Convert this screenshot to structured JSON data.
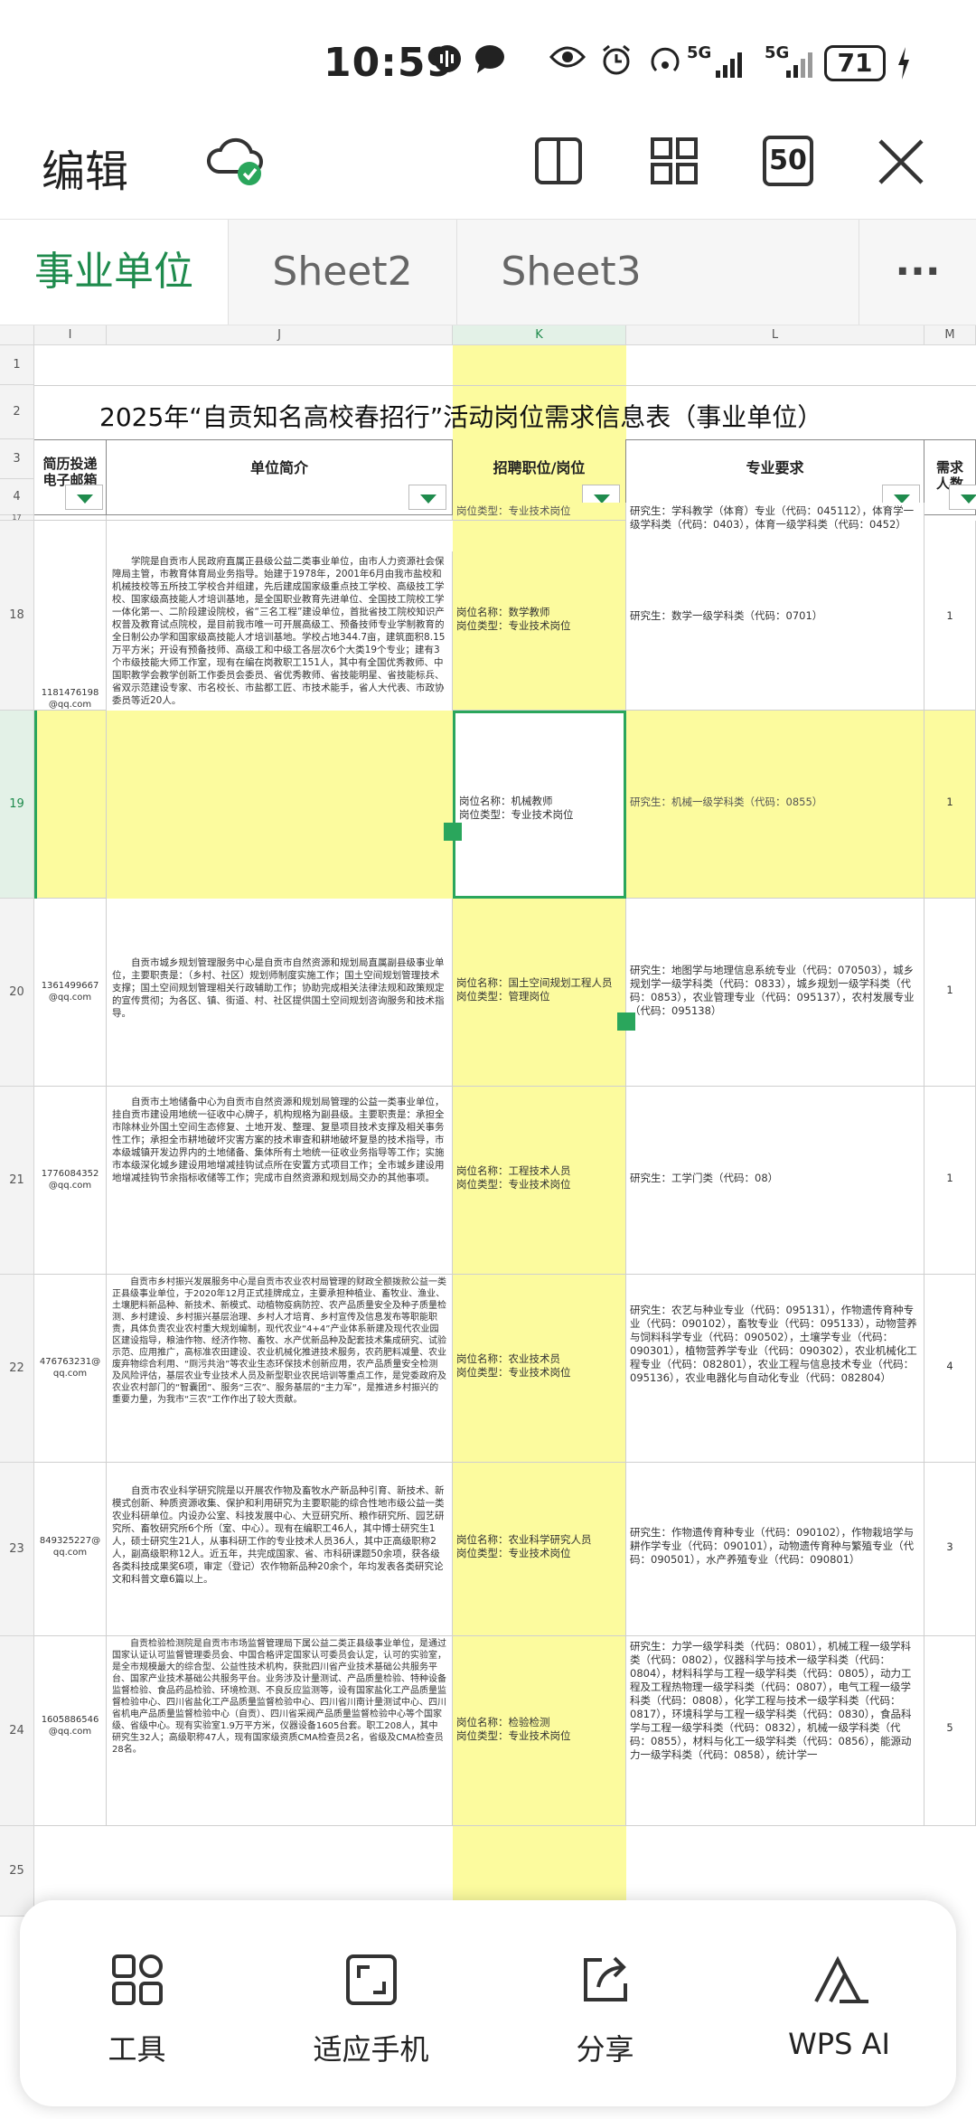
{
  "status_bar": {
    "time": "10:59",
    "signal1": "5G",
    "signal2": "5G",
    "battery": "71"
  },
  "toolbar": {
    "edit_label": "编辑",
    "zoom_value": "50"
  },
  "tabs": [
    {
      "label": "事业单位"
    },
    {
      "label": "Sheet2"
    },
    {
      "label": "Sheet3"
    }
  ],
  "more_label": "···",
  "columns": [
    "I",
    "J",
    "K",
    "L",
    "M"
  ],
  "rows": [
    "1",
    "2",
    "3",
    "4",
    "17",
    "18",
    "19",
    "20",
    "21",
    "22",
    "23",
    "24",
    "25"
  ],
  "sheet_title": "2025年“自贡知名高校春招行”活动岗位需求信息表（事业单位）",
  "headers": {
    "email": "简历投递\n电子邮箱",
    "intro": "单位简介",
    "post": "招聘职位/岗位",
    "major": "专业要求",
    "count": "需求\n人数"
  },
  "data_rows": [
    {
      "row": "17",
      "email": "",
      "intro": "",
      "post": "岗位类型：专业技术岗位",
      "major": "研究生：学科教学（体育）专业（代码：045112），体育学一级学科类（代码：0403），体育一级学科类（代码：0452）",
      "count": ""
    },
    {
      "row": "18",
      "email": "1181476198@qq.com",
      "intro": "学院是自贡市人民政府直属正县级公益二类事业单位，由市人力资源社会保障局主管，市教育体育局业务指导。始建于1978年，2001年6月由我市盐校和机械技校等五所技工学校合并组建，先后建成国家级重点技工学校、高级技工学校、国家级高技能人才培训基地，是全国职业教育先进单位、全国技工院校工学一体化第一、二阶段建设院校，省“三名工程”建设单位，首批省技工院校知识产权普及教育试点院校，是目前我市唯一可开展高级工、预备技师专业学制教育的全日制公办学和国家级高技能人才培训基地。学校占地344.7亩，建筑面积8.15万平方米；开设有预备技师、高级工和中级工各层次6个大类19个专业；建有3个市级技能大师工作室，现有在编在岗教职工151人，其中有全国优秀教师、中国职教学会教学创新工作委员会委员、省优秀教师、省技能明星、省技能标兵、省双示范建设专家、市名校长、市盐都工匠、市技术能手，省人大代表、市政协委员等近20人。",
      "post": "岗位名称：数学教师\n岗位类型：专业技术岗位",
      "major": "研究生：数学一级学科类（代码：0701）",
      "count": "1"
    },
    {
      "row": "19",
      "email": "",
      "intro": "",
      "post": "岗位名称：机械教师\n岗位类型：专业技术岗位",
      "major": "研究生：机械一级学科类（代码：0855）",
      "count": "1"
    },
    {
      "row": "20",
      "email": "1361499667@qq.com",
      "intro": "自贡市城乡规划管理服务中心是自贡市自然资源和规划局直属副县级事业单位，主要职责是：（乡村、社区）规划师制度实施工作；国土空间规划管理技术支撑；国土空间规划管理相关行政辅助工作；协助完成相关法律法规和政策规定的宣传贯彻；为各区、镇、街道、村、社区提供国土空间规划咨询服务和技术指导。",
      "post": "岗位名称：国土空间规划工程人员\n岗位类型：管理岗位",
      "major": "研究生：地图学与地理信息系统专业（代码：070503），城乡规划学一级学科类（代码：0833），城乡规划一级学科类（代码：0853），农业管理专业（代码：095137），农村发展专业（代码：095138）",
      "count": "1"
    },
    {
      "row": "21",
      "email": "1776084352@qq.com",
      "intro": "自贡市土地储备中心为自贡市自然资源和规划局管理的公益一类事业单位，挂自贡市建设用地统一征收中心牌子，机构规格为副县级。主要职责是：承担全市除林业外国土空间生态修复、土地开发、整理、复垦项目技术支撑及相关事务性工作；承担全市耕地破坏灾害方案的技术审查和耕地破坏复垦的技术指导，市本级城镇开发边界内的土地储备、集体所有土地统一征收业务指导等工作；实施市本级深化城乡建设用地增减挂钩试点所在安置方式项目工作；全市城乡建设用地增减挂钩节余指标收储等工作；完成市自然资源和规划局交办的其他事项。",
      "post": "岗位名称：工程技术人员\n岗位类型：专业技术岗位",
      "major": "研究生：工学门类（代码：08）",
      "count": "1"
    },
    {
      "row": "22",
      "email": "476763231@qq.com",
      "intro": "自贡市乡村振兴发展服务中心是自贡市农业农村局管理的财政全额拨款公益一类正县级事业单位，于2020年12月正式挂牌成立，主要承担种植业、畜牧业、渔业、土壤肥料新品种、新技术、新模式、动植物疫病防控、农产品质量安全及种子质量检测、乡村建设、乡村振兴基层治理、乡村人才培育、乡村宣传及信息发布等职能职责，具体负责农业农村重大规划编制，现代农业“4+4”产业体系新建及现代农业园区建设指导，粮油作物、经济作物、畜牧、水产优新品种及配套技术集成研究、试验示范、应用推广，高标准农田建设、农业机械化推进技术服务，农药肥料减量、农业废弃物综合利用、“厕污共治”等农业生态环保技术创新应用，农产品质量安全检测及风险评估，基层农业专业技术人员及新型职业农民培训等重点工作，是党委政府及农业农村部门的“智囊团”、服务“三农”、服务基层的“主力军”，是推进乡村振兴的重要力量，为我市“三农”工作作出了较大贡献。",
      "post": "岗位名称：农业技术员\n岗位类型：专业技术岗位",
      "major": "研究生：农艺与种业专业（代码：095131），作物遗传育种专业（代码：090102），畜牧专业（代码：095133），动物营养与饲料科学专业（代码：090502），土壤学专业（代码：090301），植物营养学专业（代码：090302），农业机械化工程专业（代码：082801），农业工程与信息技术专业（代码：095136），农业电器化与自动化专业（代码：082804）",
      "count": "4"
    },
    {
      "row": "23",
      "email": "849325227@qq.com",
      "intro": "自贡市农业科学研究院是以开展农作物及畜牧水产新品种引育、新技术、新模式创新、种质资源收集、保护和利用研究为主要职能的综合性地市级公益一类农业科研单位。内设办公室、科技发展中心、大豆研究所、粮作研究所、园艺研究所、畜牧研究所6个所（室、中心）。现有在编职工46人，其中博士研究生1人，硕士研究生21人，从事科研工作的专业技术人员36人，其中正高级职称2人，副高级职称12人。近五年，共完成国家、省、市科研课题50余项，获各级各类科技成果奖6项，审定（登记）农作物新品种20余个，年均发表各类研究论文和科普文章6篇以上。",
      "post": "岗位名称：农业科学研究人员\n岗位类型：专业技术岗位",
      "major": "研究生：作物遗传育种专业（代码：090102），作物栽培学与耕作学专业（代码：090101），动物遗传育种与繁殖专业（代码：090501），水产养殖专业（代码：090801）",
      "count": "3"
    },
    {
      "row": "24",
      "email": "1605886546@qq.com",
      "intro": "自贡检验检测院是自贡市市场监督管理局下属公益二类正县级事业单位，是通过国家认证认可监督管理委员会、中国合格评定国家认可委员会认定，认可的实验室，是全市规模最大的综合型、公益性技术机构，获批四川省产业技术基础公共服务平台、国家产业技术基础公共服务平台。业务涉及计量测试、产品质量检验、特种设备监督检验、食品药品检验、环境检测、不良反应监测等，设有国家盐化工产品质量监督检验中心、四川省盐化工产品质量监督检验中心、四川省川南计量测试中心、四川省机电产品质量监督检验中心（自贡）、四川省采阀产品质量监督检验中心等个国家级、省级中心。现有实验室1.9万平方米，仪器设备1605台套。职工208人，其中研究生32人；高级职称47人，现有国家级资质CMA检查员2名，省级及CMA检查员28名。",
      "post": "岗位名称：检验检测\n岗位类型：专业技术岗位",
      "major": "研究生：力学一级学科类（代码：0801），机械工程一级学科类（代码：0802），仪器科学与技术一级学科类（代码：0804），材料科学与工程一级学科类（代码：0805），动力工程及工程热物理一级学科类（代码：0807），电气工程一级学科类（代码：0808），化学工程与技术一级学科类（代码：0817），环境科学与工程一级学科类（代码：0830），食品科学与工程一级学科类（代码：0832），机械一级学科类（代码：0855），材料与化工一级学科类（代码：0856），能源动力一级学科类（代码：0858），统计学一",
      "count": "5"
    }
  ],
  "bottom_bar": [
    {
      "label": "工具"
    },
    {
      "label": "适应手机"
    },
    {
      "label": "分享"
    },
    {
      "label": "WPS AI"
    }
  ]
}
